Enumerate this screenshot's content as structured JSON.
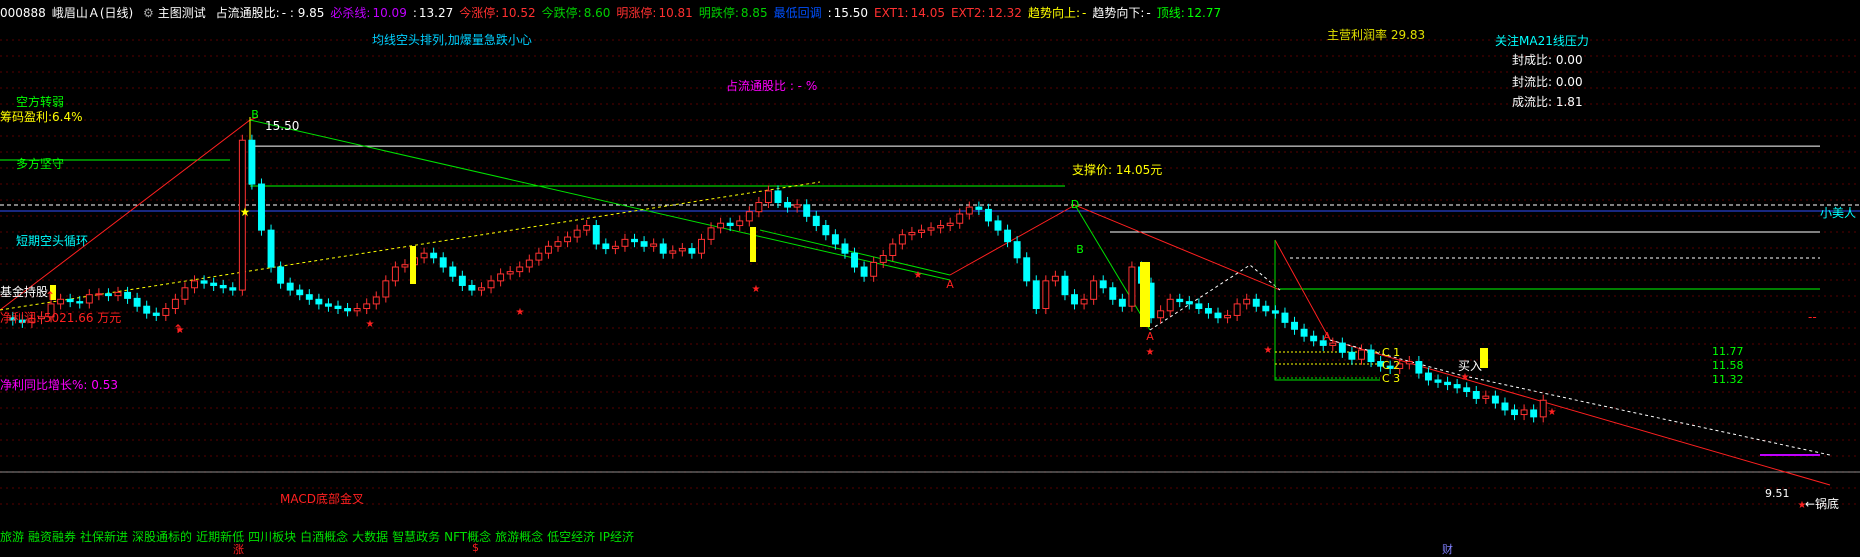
{
  "header": {
    "code": "000888",
    "name": "峨眉山Ａ",
    "period": "(日线)",
    "indicator": "主图测试",
    "items": [
      {
        "label": "占流通股比:",
        "value": "- : 9.85",
        "color": "#ffffff"
      },
      {
        "label": "必杀线:",
        "value": "10.09",
        "color": "#c000ff"
      },
      {
        "label": ":",
        "value": "13.27",
        "color": "#ffffff"
      },
      {
        "label": "今涨停:",
        "value": "10.52",
        "color": "#ff3030"
      },
      {
        "label": "今跌停:",
        "value": "8.60",
        "color": "#00d000"
      },
      {
        "label": "明涨停:",
        "value": "10.81",
        "color": "#ff3030"
      },
      {
        "label": "明跌停:",
        "value": "8.85",
        "color": "#00d000"
      },
      {
        "label": "最低回调",
        "value": "",
        "color": "#0050ff"
      },
      {
        "label": ":",
        "value": "15.50",
        "color": "#ffffff"
      },
      {
        "label": "EXT1:",
        "value": "14.05",
        "color": "#ff3030"
      },
      {
        "label": "EXT2:",
        "value": "12.32",
        "color": "#ff3030"
      },
      {
        "label": "趋势向上:",
        "value": "-",
        "color": "#ffff00"
      },
      {
        "label": "趋势向下:",
        "value": "-",
        "color": "#ffffff"
      },
      {
        "label": "顶线:",
        "value": "12.77",
        "color": "#00ff00"
      }
    ]
  },
  "labels": {
    "bearish_trend": "均线空头排列,加爆量急跌小心",
    "float_ratio": "占流通股比 : - %",
    "main_margin": "主营利润率 29.83",
    "ma21_title": "关注MA21线压力",
    "seal_ratio": "封成比: 0.00",
    "seal_flow_ratio": "封流比: 0.00",
    "deal_flow_ratio": "成流比: 1.81",
    "bull_bear_turn": "空方转弱",
    "chip_profit": "筹码盈利:6.4%",
    "bull_hold": "多方坚守",
    "short_cycle": "短期空头循环",
    "fund_control": "基金持股",
    "net_profit": "净利润: 5021.66 万元",
    "net_profit_yoy": "净利同比增长%: 0.53",
    "support_price": "支撑价: 14.05元",
    "small_beauty": "小美人",
    "macd_cross": "MACD底部金叉",
    "buy_in": "买入",
    "pot_bottom": "←锅底",
    "peak_label": "15.50",
    "low_label": "9.51",
    "c_levels": [
      {
        "name": "C 1",
        "value": "11.77"
      },
      {
        "name": "C 2",
        "value": "11.58"
      },
      {
        "name": "C 3",
        "value": "11.32"
      }
    ],
    "dashes": "--",
    "point_b": "B",
    "point_d": "D",
    "point_a": "A"
  },
  "bottom_tags": [
    "旅游",
    "融资融券",
    "社保新进",
    "深股通标的",
    "近期新低",
    "四川板块",
    "白酒概念",
    "大数据",
    "智慧政务",
    "NFT概念",
    "旅游概念",
    "低空经济",
    "IP经济"
  ],
  "bottom_markers": [
    {
      "text": "涨",
      "color": "#ff2020"
    },
    {
      "text": "$",
      "color": "#ff2020"
    },
    {
      "text": "财",
      "color": "#8080ff"
    }
  ],
  "chart_data": {
    "type": "candlestick",
    "title": "",
    "ylim": [
      8.8,
      16.5
    ],
    "grid": true,
    "x": [
      1,
      2,
      3,
      4,
      5,
      6,
      7,
      8,
      9,
      10,
      11,
      12,
      13,
      14,
      15,
      16,
      17,
      18,
      19,
      20,
      21,
      22,
      23,
      24,
      25,
      26,
      27,
      28,
      29,
      30,
      31,
      32,
      33,
      34,
      35,
      36,
      37,
      38,
      39,
      40,
      41,
      42,
      43,
      44,
      45,
      46,
      47,
      48,
      49,
      50,
      51,
      52,
      53,
      54,
      55,
      56,
      57,
      58,
      59,
      60,
      61,
      62,
      63,
      64,
      65,
      66,
      67,
      68,
      69,
      70,
      71,
      72,
      73,
      74,
      75,
      76,
      77,
      78,
      79,
      80,
      81,
      82,
      83,
      84,
      85,
      86,
      87,
      88,
      89,
      90,
      91,
      92,
      93,
      94,
      95,
      96,
      97,
      98,
      99,
      100,
      101,
      102,
      103,
      104,
      105,
      106,
      107,
      108,
      109,
      110,
      111,
      112,
      113,
      114,
      115,
      116,
      117,
      118,
      119,
      120,
      121,
      122,
      123,
      124,
      125,
      126,
      127,
      128,
      129,
      130,
      131,
      132,
      133,
      134,
      135,
      136,
      137,
      138,
      139,
      140,
      141,
      142,
      143,
      144,
      145,
      146,
      147,
      148,
      149,
      150,
      151,
      152,
      153,
      154,
      155,
      156,
      157,
      158,
      159,
      160,
      161,
      162,
      163,
      164,
      165,
      166,
      167,
      168,
      169,
      170,
      171,
      172,
      173,
      174,
      175,
      176,
      177,
      178,
      179,
      180,
      181,
      182,
      183,
      184,
      185,
      186,
      187,
      188,
      189,
      190
    ],
    "open": [
      11.3,
      11.25,
      11.2,
      11.28,
      11.32,
      11.6,
      11.7,
      11.65,
      11.62,
      11.8,
      11.82,
      11.78,
      11.85,
      11.72,
      11.55,
      11.4,
      11.35,
      11.5,
      11.7,
      11.95,
      12.1,
      12.05,
      12.0,
      11.95,
      11.9,
      15.15,
      14.2,
      13.2,
      12.4,
      12.05,
      11.9,
      11.8,
      11.7,
      11.6,
      11.55,
      11.5,
      11.45,
      11.5,
      11.6,
      11.75,
      12.1,
      12.4,
      12.45,
      12.6,
      12.7,
      12.6,
      12.4,
      12.2,
      12.0,
      11.9,
      11.95,
      12.1,
      12.25,
      12.3,
      12.4,
      12.55,
      12.7,
      12.85,
      12.95,
      13.05,
      13.2,
      13.3,
      12.9,
      12.8,
      12.85,
      13.0,
      12.95,
      12.85,
      12.9,
      12.7,
      12.75,
      12.8,
      12.7,
      13.0,
      13.25,
      13.35,
      13.3,
      13.4,
      13.6,
      13.8,
      14.05,
      13.8,
      13.7,
      13.75,
      13.5,
      13.3,
      13.1,
      12.9,
      12.7,
      12.4,
      12.2,
      12.5,
      12.65,
      12.9,
      13.1,
      13.15,
      13.2,
      13.25,
      13.3,
      13.35,
      13.55,
      13.7,
      13.65,
      13.4,
      13.2,
      12.95,
      12.6,
      12.1,
      11.5,
      12.1,
      12.2,
      11.8,
      11.6,
      11.7,
      12.1,
      11.95,
      11.7,
      11.55,
      12.4,
      12.05,
      11.3,
      11.45,
      11.7,
      11.65,
      11.6,
      11.5,
      11.4,
      11.3,
      11.35,
      11.6,
      11.7,
      11.55,
      11.45,
      11.4,
      11.2,
      11.05,
      10.9,
      10.8,
      10.7,
      10.75,
      10.55,
      10.4,
      10.6,
      10.35,
      10.25,
      10.2,
      10.3,
      10.35,
      10.1,
      9.95,
      9.9,
      9.85,
      9.78,
      9.7,
      9.55,
      9.6,
      9.45,
      9.3,
      9.2,
      9.3,
      9.15
    ],
    "close": [
      11.25,
      11.2,
      11.28,
      11.32,
      11.6,
      11.7,
      11.65,
      11.62,
      11.8,
      11.82,
      11.78,
      11.85,
      11.72,
      11.55,
      11.4,
      11.35,
      11.5,
      11.7,
      11.95,
      12.1,
      12.05,
      12.0,
      11.95,
      11.9,
      15.15,
      14.2,
      13.2,
      12.4,
      12.05,
      11.9,
      11.8,
      11.7,
      11.6,
      11.55,
      11.5,
      11.45,
      11.5,
      11.6,
      11.75,
      12.1,
      12.4,
      12.45,
      12.6,
      12.7,
      12.6,
      12.4,
      12.2,
      12.0,
      11.9,
      11.95,
      12.1,
      12.25,
      12.3,
      12.4,
      12.55,
      12.7,
      12.85,
      12.95,
      13.05,
      13.2,
      13.3,
      12.9,
      12.8,
      12.85,
      13.0,
      12.95,
      12.85,
      12.9,
      12.7,
      12.75,
      12.8,
      12.7,
      13.0,
      13.25,
      13.35,
      13.3,
      13.4,
      13.6,
      13.8,
      14.05,
      13.8,
      13.7,
      13.75,
      13.5,
      13.3,
      13.1,
      12.9,
      12.7,
      12.4,
      12.2,
      12.5,
      12.65,
      12.9,
      13.1,
      13.15,
      13.2,
      13.25,
      13.3,
      13.35,
      13.55,
      13.7,
      13.65,
      13.4,
      13.2,
      12.95,
      12.6,
      12.1,
      11.5,
      12.1,
      12.2,
      11.8,
      11.6,
      11.7,
      12.1,
      11.95,
      11.7,
      11.55,
      12.4,
      12.05,
      11.3,
      11.45,
      11.7,
      11.65,
      11.6,
      11.5,
      11.4,
      11.3,
      11.35,
      11.6,
      11.7,
      11.55,
      11.45,
      11.4,
      11.2,
      11.05,
      10.9,
      10.8,
      10.7,
      10.75,
      10.55,
      10.4,
      10.6,
      10.35,
      10.25,
      10.2,
      10.3,
      10.35,
      10.1,
      9.95,
      9.9,
      9.85,
      9.78,
      9.7,
      9.55,
      9.6,
      9.45,
      9.3,
      9.2,
      9.3,
      9.15,
      9.51
    ],
    "volume_note": "",
    "levels": {
      "peak": 15.5,
      "support": 14.05,
      "ext2": 12.32,
      "top_line": 12.77,
      "low": 9.51
    }
  },
  "colors": {
    "up": "#ff3232",
    "down": "#00ffff",
    "grid": "#b00000",
    "gold": "#ffff00",
    "green": "#00ff00",
    "white": "#ffffff",
    "magenta": "#ff00ff",
    "blue": "#3050ff",
    "cyan": "#00ffff"
  }
}
